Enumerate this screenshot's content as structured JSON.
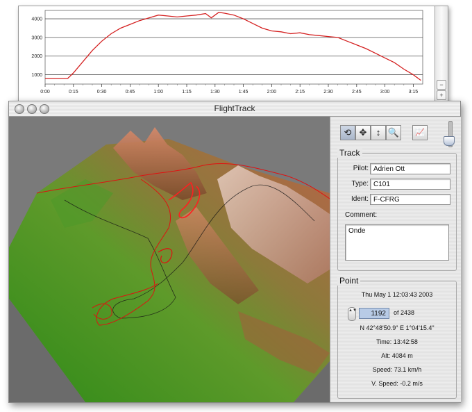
{
  "profile": {
    "y_ticks": [
      "4000",
      "3000",
      "2000",
      "1000"
    ],
    "x_ticks": [
      "0:00",
      "0:15",
      "0:30",
      "0:45",
      "1:00",
      "1:15",
      "1:30",
      "1:45",
      "2:00",
      "2:15",
      "2:30",
      "2:45",
      "3:00",
      "3:15"
    ],
    "zoom_out": "−",
    "zoom_in": "+"
  },
  "chart_data": {
    "type": "line",
    "xlabel": "",
    "ylabel": "",
    "ylim": [
      500,
      4300
    ],
    "y_unit_ticks": [
      1000,
      2000,
      3000,
      4000
    ],
    "x_minutes": [
      0,
      12,
      15,
      20,
      25,
      30,
      35,
      40,
      45,
      50,
      55,
      60,
      65,
      70,
      75,
      80,
      85,
      88,
      92,
      95,
      100,
      105,
      110,
      115,
      120,
      125,
      130,
      135,
      140,
      145,
      150,
      155,
      160,
      165,
      170,
      175,
      180,
      185,
      190,
      195,
      199
    ],
    "y_values": [
      800,
      800,
      1100,
      1700,
      2300,
      2800,
      3200,
      3500,
      3700,
      3900,
      4050,
      4200,
      4150,
      4100,
      4150,
      4200,
      4280,
      4050,
      4350,
      4300,
      4200,
      4000,
      3750,
      3500,
      3350,
      3300,
      3200,
      3250,
      3150,
      3100,
      3050,
      3000,
      2800,
      2600,
      2400,
      2150,
      1900,
      1650,
      1300,
      1000,
      700
    ]
  },
  "window": {
    "title": "FlightTrack"
  },
  "toolbar": {
    "tools": [
      "rotate-tool-icon",
      "move-tool-icon",
      "vertical-move-icon",
      "zoom-tool-icon"
    ],
    "tool_glyphs": [
      "⟲",
      "✥",
      "↕",
      "🔍"
    ],
    "graph_glyph": "📈"
  },
  "track": {
    "section_title": "Track",
    "pilot_label": "Pilot:",
    "pilot_value": "Adrien Ott",
    "type_label": "Type:",
    "type_value": "C101",
    "ident_label": "Ident:",
    "ident_value": "F-CFRG",
    "comment_label": "Comment:",
    "comment_value": "Onde"
  },
  "point": {
    "section_title": "Point",
    "datetime": "Thu May  1 12:03:43 2003",
    "index": "1192",
    "of_total": "of 2438",
    "coords": "N 42°48'50.9\"  E 1°04'15.4\"",
    "time": "Time: 13:42:58",
    "alt": "Alt: 4084 m",
    "speed": "Speed: 73.1 km/h",
    "vspeed": "V. Speed: -0.2 m/s",
    "stepper": "▲▼"
  },
  "colors": {
    "profile_line": "#d42020",
    "track_line": "#e01010",
    "terrain_low": "#3c9a1f",
    "terrain_high": "#b7553a",
    "selection": "#b8cbe6"
  }
}
